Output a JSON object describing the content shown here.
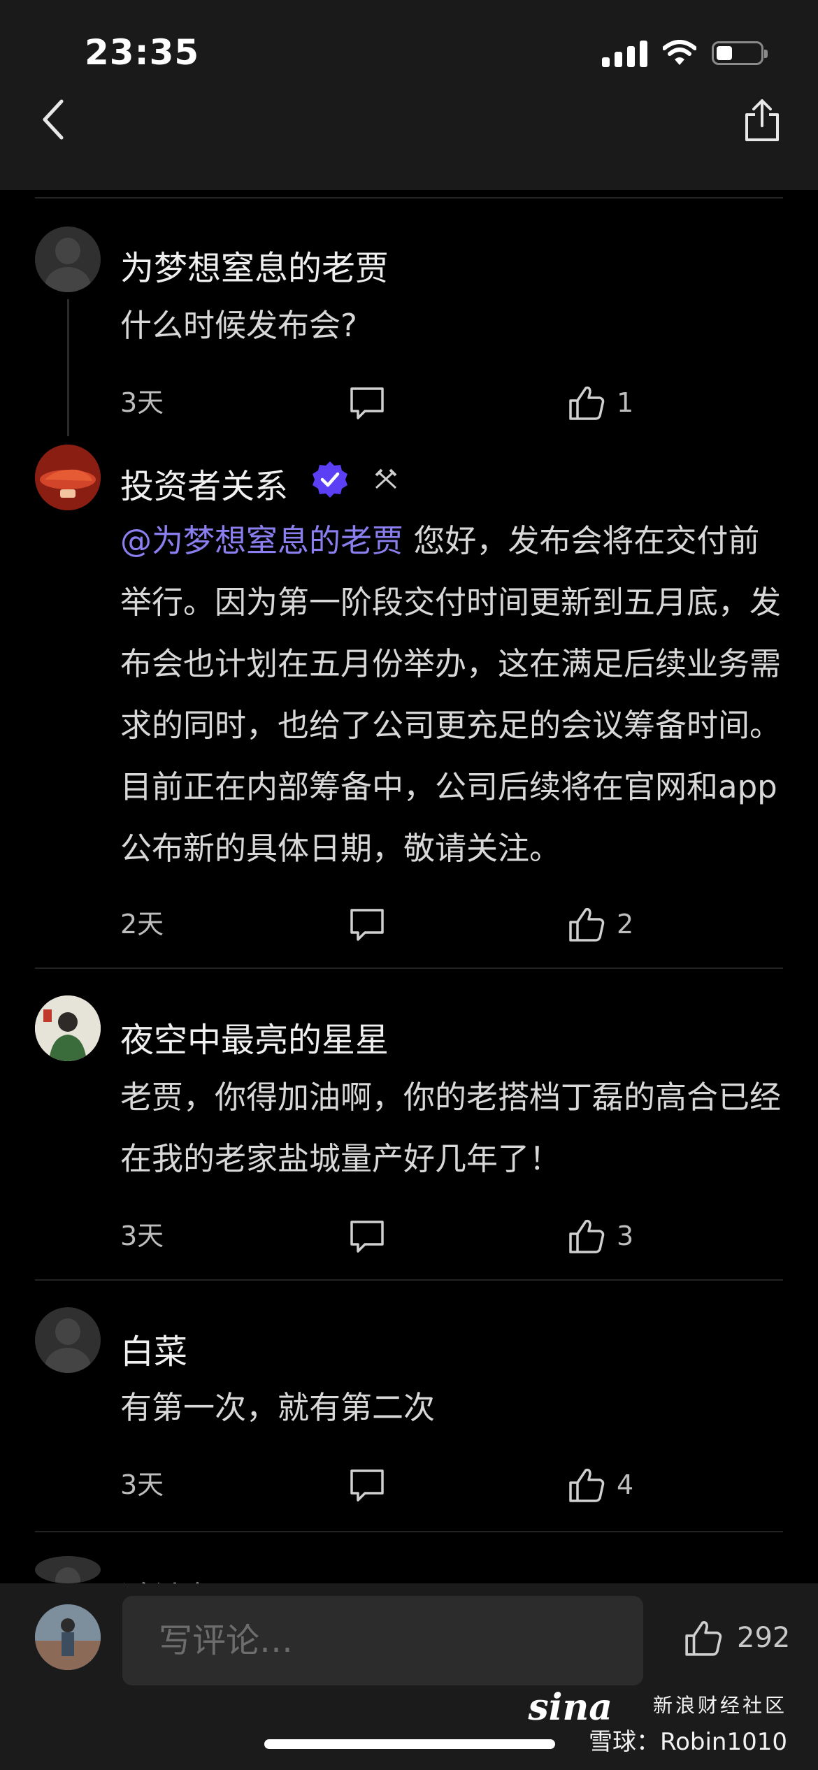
{
  "status_bar": {
    "time": "23:35"
  },
  "comments": [
    {
      "username": "为梦想窒息的老贾",
      "text": "什么时候发布会?",
      "age": "3天",
      "likes": "1"
    },
    {
      "username": "投资者关系",
      "verified": true,
      "mention": "@为梦想窒息的老贾",
      "text": " 您好，发布会将在交付前举行。因为第一阶段交付时间更新到五月底，发布会也计划在五月份举办，这在满足后续业务需求的同时，也给了公司更充足的会议筹备时间。目前正在内部筹备中，公司后续将在官网和app公布新的具体日期，敬请关注。",
      "age": "2天",
      "likes": "2"
    },
    {
      "username": "夜空中最亮的星星",
      "text": "老贾，你得加油啊，你的老搭档丁磊的高合已经在我的老家盐城量产好几年了！",
      "age": "3天",
      "likes": "3"
    },
    {
      "username": "白菜",
      "text": "有第一次，就有第二次",
      "age": "3天",
      "likes": "4"
    }
  ],
  "partial_next_username": "鸿沐频",
  "bottom_bar": {
    "input_placeholder": "写评论…",
    "like_count": "292"
  },
  "watermark": {
    "brand": "sina",
    "line1": "新浪财经社区",
    "line2": "雪球：Robin1010"
  },
  "colors": {
    "background": "#000000",
    "mention": "#8b7ff0",
    "verified": "#5b3ff5"
  }
}
